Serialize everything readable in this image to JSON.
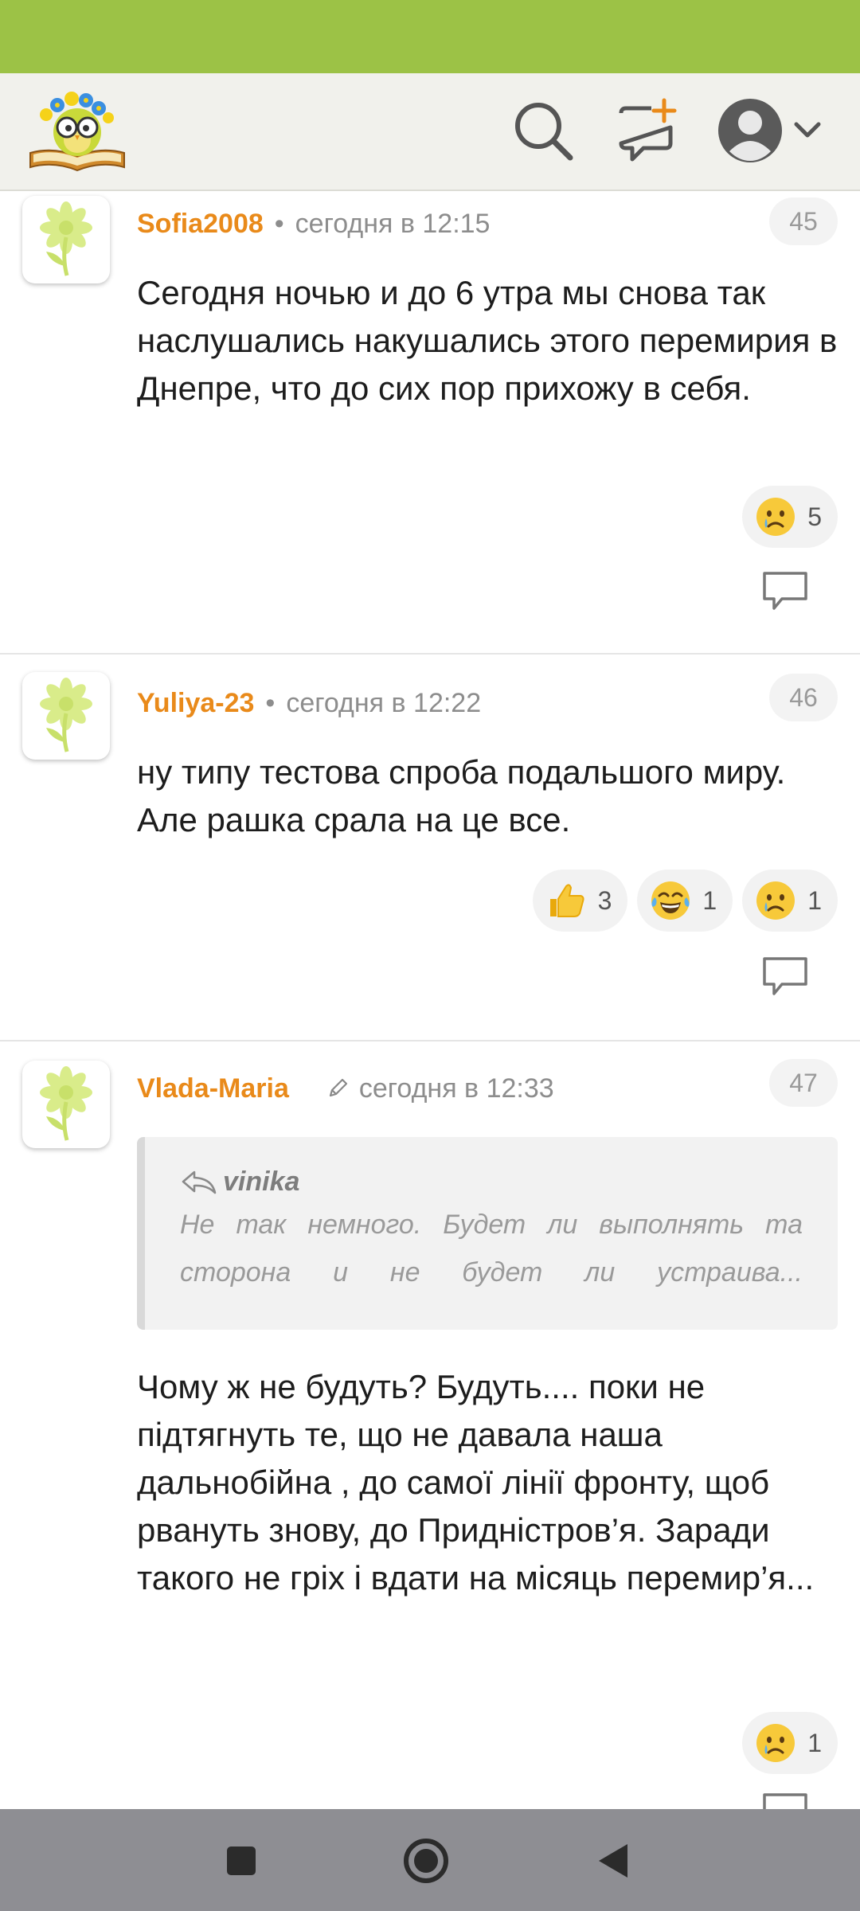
{
  "header": {
    "logo_icon": "owl-on-book-logo",
    "search_icon": "search-icon",
    "new_post_icon": "new-message-plus-icon",
    "profile_icon": "user-avatar-icon",
    "menu_icon": "chevron-down-icon"
  },
  "colors": {
    "status_bar": "#9cc246",
    "author": "#e98a1a",
    "header_bg": "#f1f1ec",
    "nav_bar": "#8e8e93"
  },
  "comments": [
    {
      "author": "Sofia2008",
      "separator": "•",
      "time": "сегодня в 12:15",
      "number": "45",
      "text": "Сегодня ночью и до 6 утра мы снова так наслушались накушались этого перемирия в Днепре, что до сих пор прихожу в себя.",
      "reactions": [
        {
          "emoji": "crying-face",
          "count": "5"
        }
      ]
    },
    {
      "author": "Yuliya-23",
      "separator": "•",
      "time": "сегодня в 12:22",
      "number": "46",
      "text": "ну типу тестова спроба подальшого миру. Але рашка срала на це все.",
      "reactions": [
        {
          "emoji": "thumbs-up",
          "count": "3"
        },
        {
          "emoji": "tears-of-joy",
          "count": "1"
        },
        {
          "emoji": "crying-face",
          "count": "1"
        }
      ]
    },
    {
      "author": "Vlada-Maria",
      "edited_icon": "pencil-icon",
      "time": "сегодня в 12:33",
      "number": "47",
      "quote": {
        "author": "vinika",
        "text": "Не так немного. Будет ли выполнять та сторона и не будет ли устраива..."
      },
      "text": "Чому ж не будуть? Будуть.... поки не підтягнуть те, що не давала наша дальнобійна , до самої лінії фронту, щоб рвануть знову, до Придністров’я. Заради такого не гріх і вдати на місяць перемир’я...",
      "reactions": [
        {
          "emoji": "crying-face",
          "count": "1"
        }
      ]
    }
  ],
  "nav": {
    "recents_icon": "square-recents-icon",
    "home_icon": "circle-home-icon",
    "back_icon": "triangle-back-icon"
  }
}
